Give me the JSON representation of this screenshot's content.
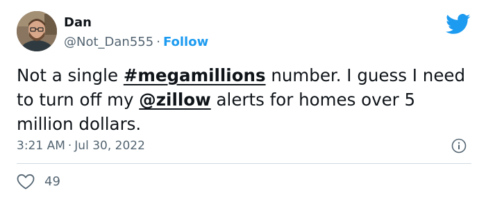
{
  "author": {
    "name": "Dan",
    "handle": "@Not_Dan555",
    "separator": "·",
    "follow_label": "Follow"
  },
  "tweet": {
    "text_part1": "Not a single ",
    "hashtag": "#megamillions",
    "text_part2": " number. I guess I need to turn off my ",
    "mention": "@zillow",
    "text_part3": " alerts for homes over 5 million dollars."
  },
  "meta": {
    "time": "3:21 AM",
    "separator": "·",
    "date": "Jul 30, 2022"
  },
  "actions": {
    "like_count": "49"
  },
  "icons": {
    "brand": "twitter-bird-icon",
    "info": "info-icon",
    "like": "heart-icon"
  },
  "colors": {
    "accent": "#1d9bf0",
    "secondary_text": "#536471",
    "primary_text": "#0f1419",
    "divider": "#cfd9de"
  }
}
